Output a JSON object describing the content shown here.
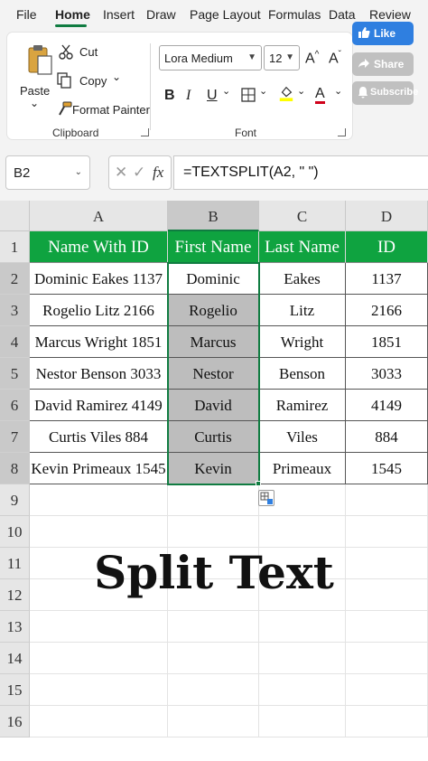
{
  "menu": {
    "tabs": [
      "File",
      "Home",
      "Insert",
      "Draw",
      "Page Layout",
      "Formulas",
      "Data",
      "Review"
    ],
    "active_tab": "Home"
  },
  "ribbon": {
    "clipboard": {
      "paste_label": "Paste",
      "paste_arrow": "⌄",
      "cut_label": "Cut",
      "copy_label": "Copy",
      "copy_arrow": "⌄",
      "format_painter_label": "Format Painter",
      "group_label": "Clipboard"
    },
    "font": {
      "font_name": "Lora Medium",
      "font_size": "12",
      "grow_label": "A",
      "grow_sup": "^",
      "shrink_label": "A",
      "shrink_sup": "ˇ",
      "bold": "B",
      "italic": "I",
      "underline": "U",
      "underline_arrow": "⌄",
      "borders_arrow": "⌄",
      "fill_arrow": "⌄",
      "font_color_label": "A",
      "font_color_arrow": "⌄",
      "group_label": "Font",
      "fill_color": "#ffff00",
      "font_color": "#d0021b"
    }
  },
  "social": {
    "like": "Like",
    "share": "Share",
    "subscribe": "Subscribe"
  },
  "formula_bar": {
    "name_box": "B2",
    "formula": "=TEXTSPLIT(A2, \" \")",
    "cancel_glyph": "✕",
    "enter_glyph": "✓",
    "fx_glyph": "fx"
  },
  "sheet": {
    "columns": [
      "A",
      "B",
      "C",
      "D"
    ],
    "rows": [
      "1",
      "2",
      "3",
      "4",
      "5",
      "6",
      "7",
      "8",
      "9",
      "10",
      "11",
      "12",
      "13",
      "14",
      "15",
      "16"
    ],
    "headers": [
      "Name With ID",
      "First Name",
      "Last Name",
      "ID"
    ],
    "data": [
      [
        "Dominic Eakes 1137",
        "Dominic",
        "Eakes",
        "1137"
      ],
      [
        "Rogelio Litz 2166",
        "Rogelio",
        "Litz",
        "2166"
      ],
      [
        "Marcus Wright 1851",
        "Marcus",
        "Wright",
        "1851"
      ],
      [
        "Nestor Benson 3033",
        "Nestor",
        "Benson",
        "3033"
      ],
      [
        "David Ramirez 4149",
        "David",
        "Ramirez",
        "4149"
      ],
      [
        "Curtis Viles 884",
        "Curtis",
        "Viles",
        "884"
      ],
      [
        "Kevin Primeaux 1545",
        "Kevin",
        "Primeaux",
        "1545"
      ]
    ],
    "header_color": "#0fa340",
    "selected_column": "B",
    "active_cell": "B2"
  },
  "overlay_title": "Split Text"
}
